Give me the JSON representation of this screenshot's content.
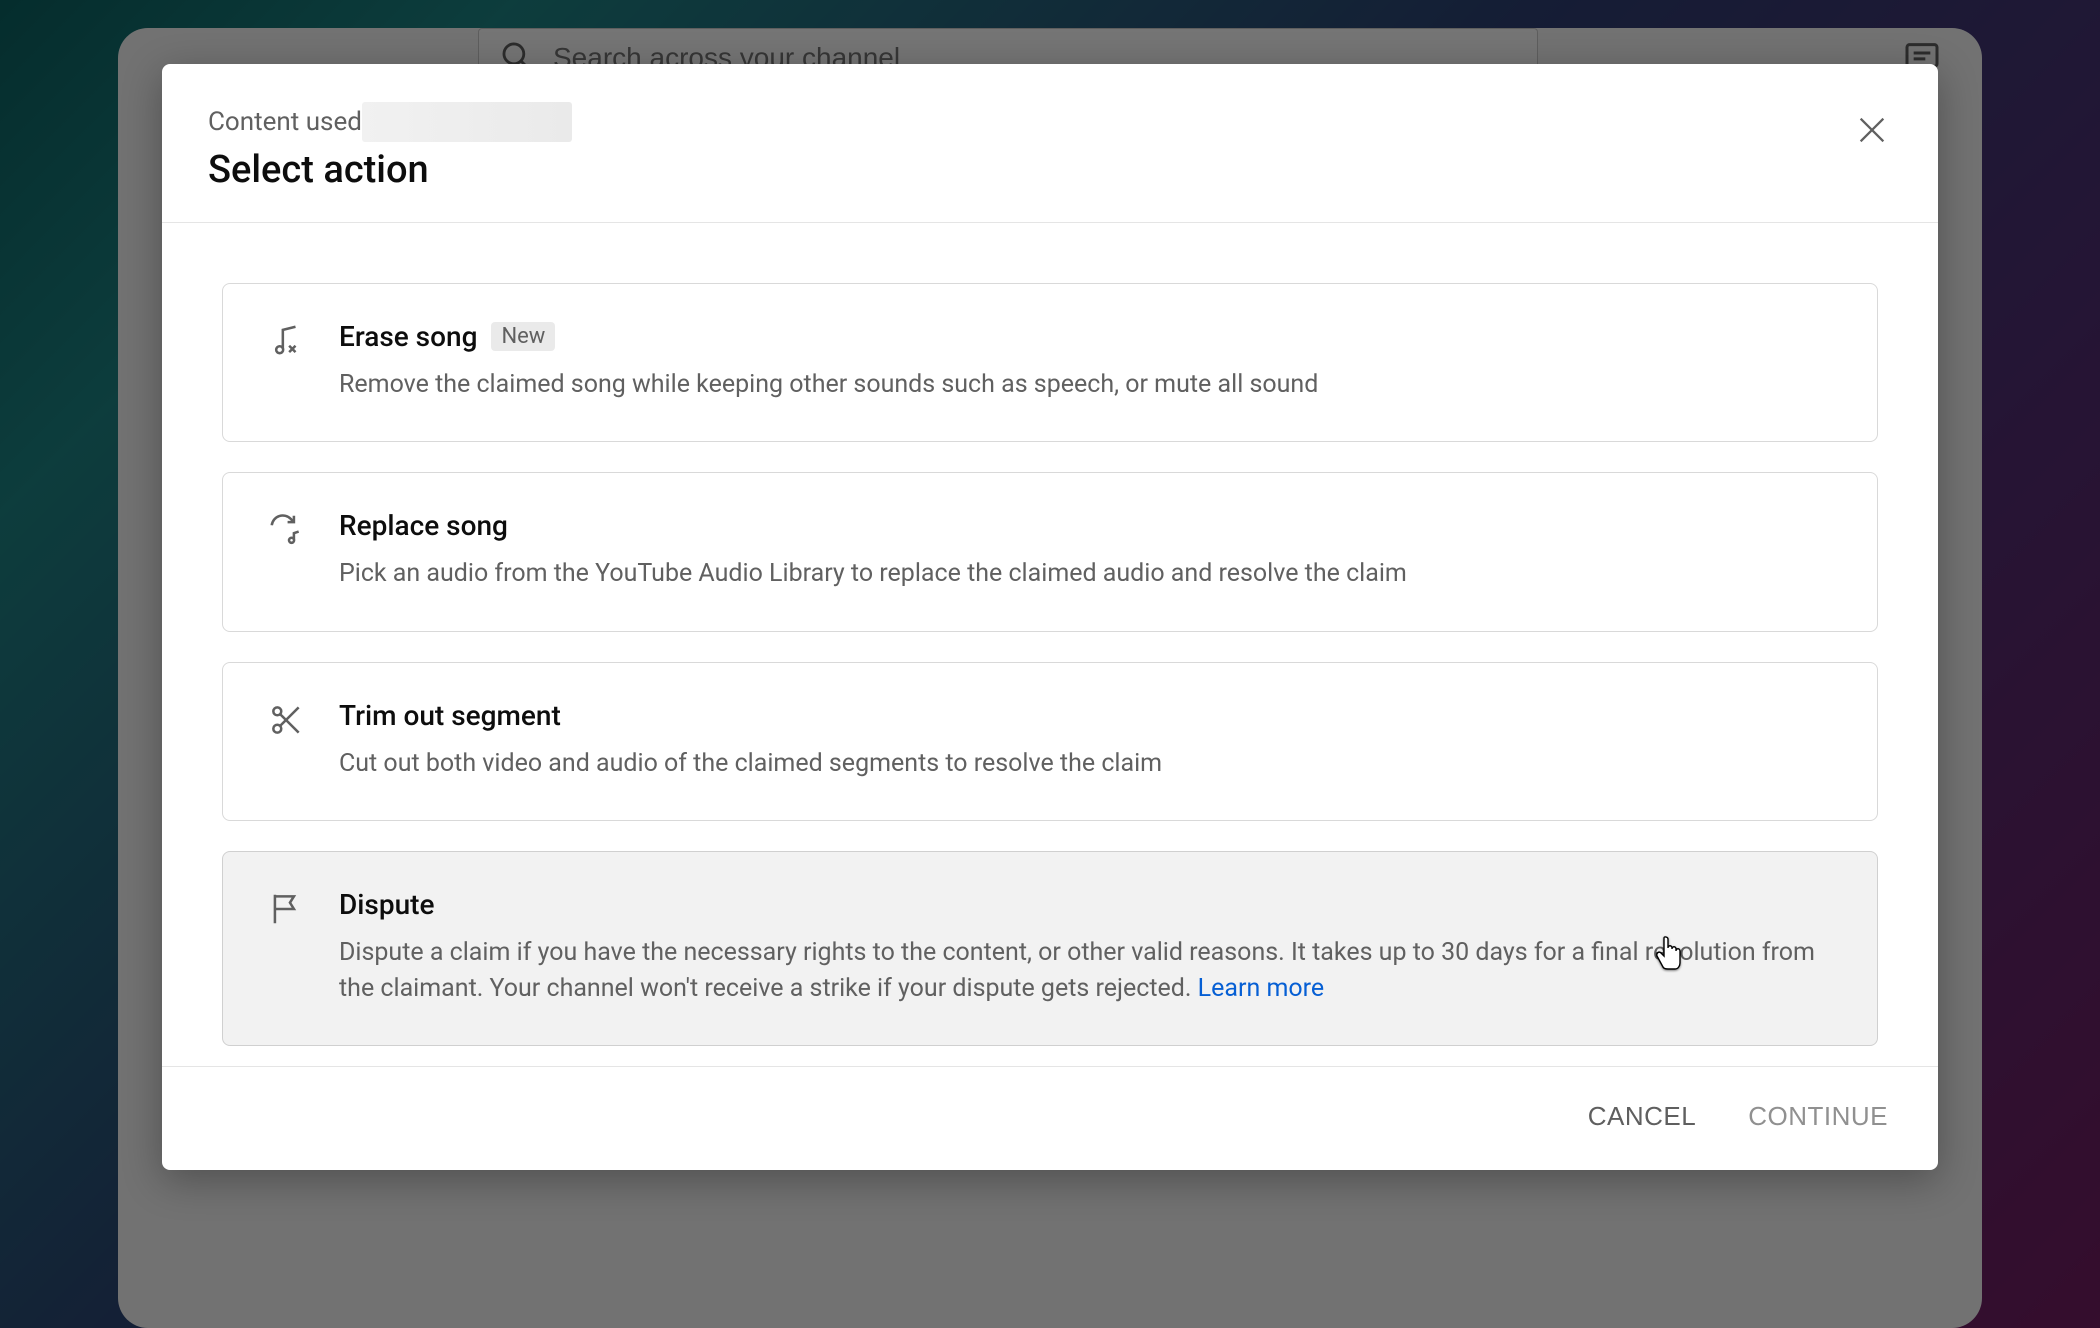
{
  "search": {
    "placeholder": "Search across your channel"
  },
  "modal": {
    "breadcrumb": "Content used",
    "title": "Select action",
    "options": {
      "erase": {
        "title": "Erase song",
        "badge": "New",
        "desc": "Remove the claimed song while keeping other sounds such as speech, or mute all sound"
      },
      "replace": {
        "title": "Replace song",
        "desc": "Pick an audio from the YouTube Audio Library to replace the claimed audio and resolve the claim"
      },
      "trim": {
        "title": "Trim out segment",
        "desc": "Cut out both video and audio of the claimed segments to resolve the claim"
      },
      "dispute": {
        "title": "Dispute",
        "desc": "Dispute a claim if you have the necessary rights to the content, or other valid reasons. It takes up to 30 days for a final resolution from the claimant. Your channel won't receive a strike if your dispute gets rejected. ",
        "learn_more": "Learn more"
      }
    },
    "buttons": {
      "cancel": "CANCEL",
      "continue": "CONTINUE"
    }
  }
}
